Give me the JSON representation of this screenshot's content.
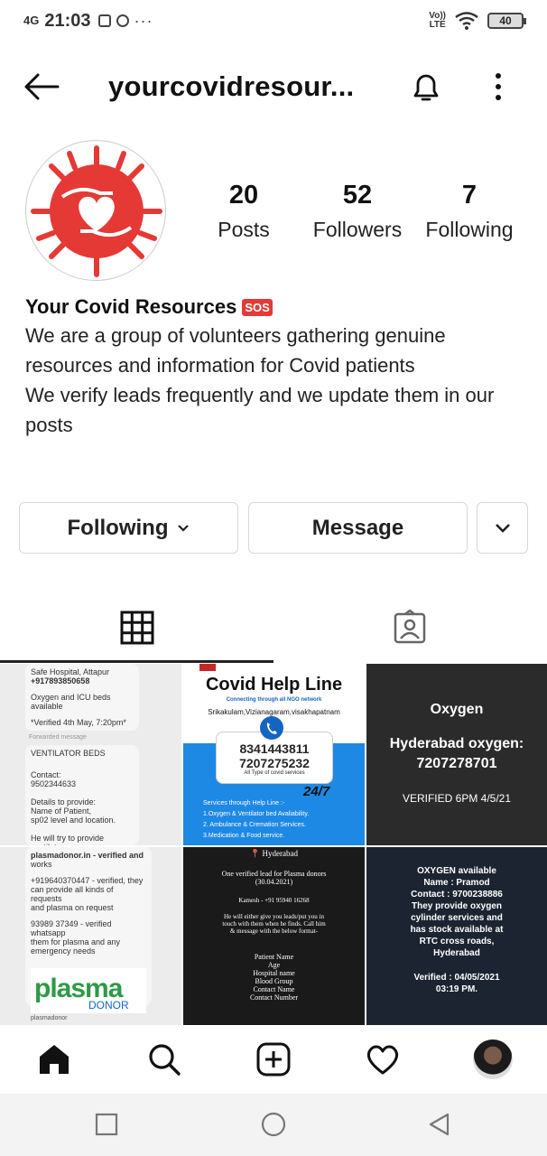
{
  "status_bar": {
    "network": "4G",
    "time": "21:03",
    "overflow": "···",
    "volte": "Vo))",
    "lte": "LTE",
    "battery": "40"
  },
  "header": {
    "username": "yourcovidresour..."
  },
  "profile": {
    "stats": [
      {
        "value": "20",
        "label": "Posts"
      },
      {
        "value": "52",
        "label": "Followers"
      },
      {
        "value": "7",
        "label": "Following"
      }
    ],
    "name": "Your Covid Resources",
    "badge": "SOS",
    "bio_lines": [
      "We are a group of volunteers gathering genuine",
      "resources and information for Covid patients",
      "We verify leads frequently and we update them in our",
      "posts"
    ]
  },
  "actions": {
    "following_label": "Following",
    "message_label": "Message"
  },
  "posts": {
    "post1": {
      "lines": [
        "Safe Hospital, Attapur",
        "+917893850658",
        "Oxygen and ICU beds available",
        "*Verified 4th May, 7:20pm*",
        "Forwarded message",
        "VENTILATOR BEDS",
        "Contact:",
        "9502344633",
        "Details to provide:",
        "Name of Patient,",
        "sp02 level and location.",
        "He will try to provide ventilator"
      ]
    },
    "post2": {
      "title": "Covid Help Line",
      "subtitle": "Connecting through all NGO network",
      "places": "Srikakulam,Vizianagaram,visakhapatnam",
      "phone1": "8341443811",
      "phone2": "7207275232",
      "phone_note": "All Type of covid services",
      "badge": "24/7",
      "services_title": "Services through Help Line :-",
      "services": [
        "1.Oxygen & Ventilator bed Avaliability.",
        "2. Ambulance & Cremation Services.",
        "3.Medication & Food service."
      ]
    },
    "post3": {
      "title": "Oxygen",
      "line1": "Hyderabad oxygen:",
      "line2": "7207278701",
      "verified": "VERIFIED 6PM 4/5/21"
    },
    "post4": {
      "lines": [
        "plasmadonor.in - verified and",
        "works",
        "+919640370447 - verified, they",
        "can provide all kinds of requests",
        "and plasma on request",
        "93989 37349 - verified whatsapp",
        "them for plasma and any",
        "emergency needs"
      ],
      "logo_a": "plasma",
      "logo_b": "DONOR",
      "footer": "plasmadonor"
    },
    "post5": {
      "city": "Hyderabad",
      "intro": [
        "One verified lead for Plasma donors",
        "(30.04.2021)"
      ],
      "contact": "Kamesh - +91 95940 16268",
      "body": [
        "He will either give you leads/put you in",
        "touch with them when he finds. Call him",
        "& message with the below format-"
      ],
      "format": [
        "Patient Name",
        "Age",
        "Hospital name",
        "Blood Group",
        "Contact Name",
        "Contact Number"
      ]
    },
    "post6": {
      "lines": [
        "OXYGEN available",
        "Name : Pramod",
        "Contact : 9700238886",
        "They provide oxygen",
        "cylinder services and",
        "has stock available at",
        "RTC cross roads,",
        "Hyderabad"
      ],
      "verified": "Verified : 04/05/2021",
      "time": "03:19 PM."
    }
  },
  "colors": {
    "covid_red": "#e53935",
    "helpline_blue": "#1e88e5",
    "dark_post": "#2b2b2b",
    "navy_post": "#1c2431"
  }
}
